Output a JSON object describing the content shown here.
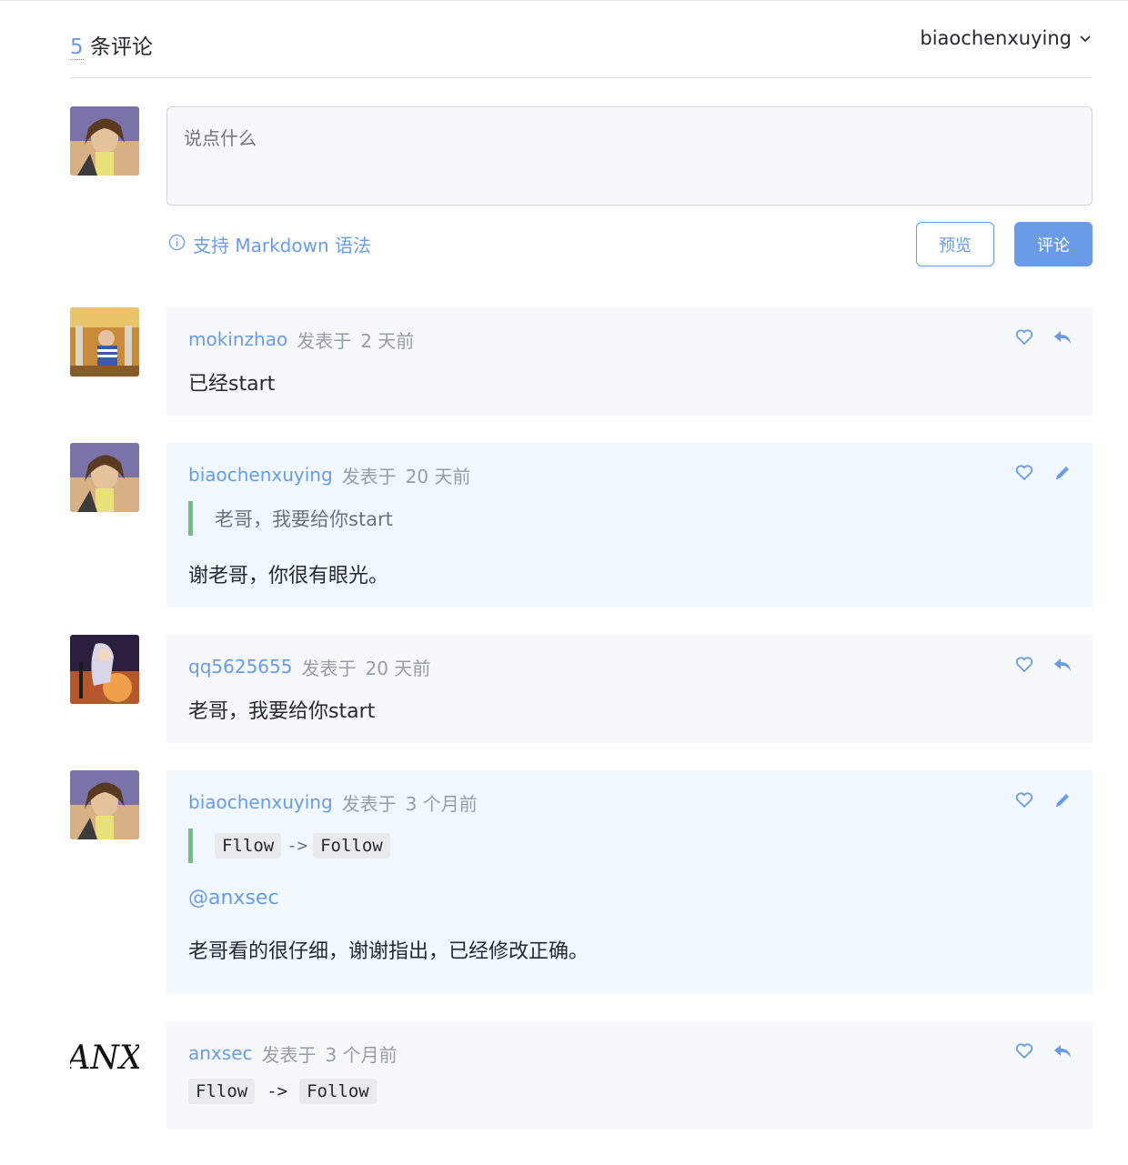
{
  "header": {
    "count": "5",
    "count_label": "条评论",
    "username": "biaochenxuying"
  },
  "editor": {
    "placeholder": "说点什么"
  },
  "hint": {
    "label": "支持 Markdown 语法"
  },
  "buttons": {
    "preview": "预览",
    "submit": "评论"
  },
  "comments": [
    {
      "author": "mokinzhao",
      "posted_label": "发表于",
      "time": "2 天前",
      "body": "已经start"
    },
    {
      "author": "biaochenxuying",
      "posted_label": "发表于",
      "time": "20 天前",
      "quote": "老哥，我要给你start",
      "body": "谢老哥，你很有眼光。"
    },
    {
      "author": "qq5625655",
      "posted_label": "发表于",
      "time": "20 天前",
      "body": "老哥，我要给你start"
    },
    {
      "author": "biaochenxuying",
      "posted_label": "发表于",
      "time": "3 个月前",
      "quote_code_a": "Fllow",
      "quote_arrow": "->",
      "quote_code_b": "Follow",
      "mention": "@anxsec",
      "body": "老哥看的很仔细，谢谢指出，已经修改正确。"
    },
    {
      "author": "anxsec",
      "posted_label": "发表于",
      "time": "3 个月前",
      "code_a": "Fllow",
      "arrow": "->",
      "code_b": "Follow",
      "avatar_text": "ANX"
    }
  ],
  "colors": {
    "accent": "#6a9be6",
    "quote_bar": "#6fc07a",
    "comment_bg": "#f6f8fa",
    "own_comment_bg": "#f1f8ff"
  }
}
